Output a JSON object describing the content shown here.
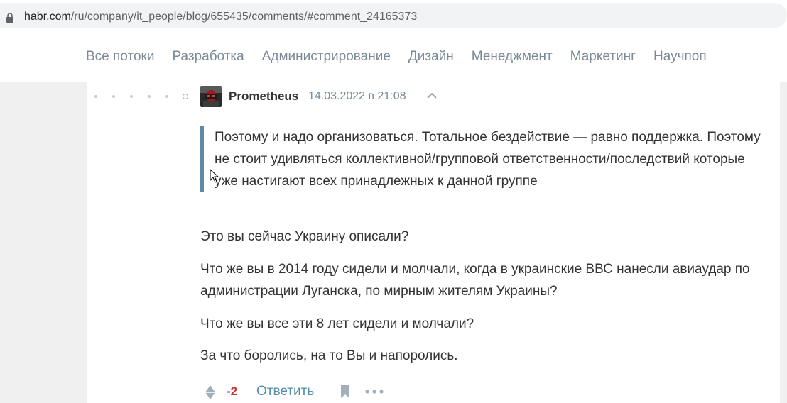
{
  "browser": {
    "url_host": "habr.com",
    "url_path": "/ru/company/it_people/blog/655435/comments/#comment_24165373"
  },
  "nav": {
    "items": [
      "Все потоки",
      "Разработка",
      "Администрирование",
      "Дизайн",
      "Менеджмент",
      "Маркетинг",
      "Научпоп"
    ]
  },
  "comment": {
    "author": "Prometheus",
    "date": "14.03.2022 в 21:08",
    "quote": "Поэтому и надо организоваться. Тотальное бездействие — равно поддержка. Поэтому не стоит удивляться коллективной/групповой ответственности/последствий которые уже настигают всех принадлежных к данной группе",
    "paragraphs": [
      "Это вы сейчас Украину описали?",
      "Что же вы в 2014 году сидели и молчали, когда в украинские ВВС нанесли авиаудар по администрации Луганска, по мирным жителям Украины?",
      "Что же вы все эти 8 лет сидели и молчали?",
      "За что боролись, на то Вы и напоролись."
    ],
    "score": "-2",
    "reply_label": "Ответить"
  },
  "colors": {
    "accent": "#548eaa",
    "quote_border": "#5e8aa7",
    "negative": "#c0392b",
    "nav_text": "#7b8a96"
  },
  "icons": {
    "lock": "lock-icon",
    "collapse": "chevron-up-icon",
    "vote": "vote-diamond-icon",
    "bookmark": "bookmark-icon",
    "more": "more-dots-icon",
    "cursor": "mouse-cursor-icon"
  }
}
